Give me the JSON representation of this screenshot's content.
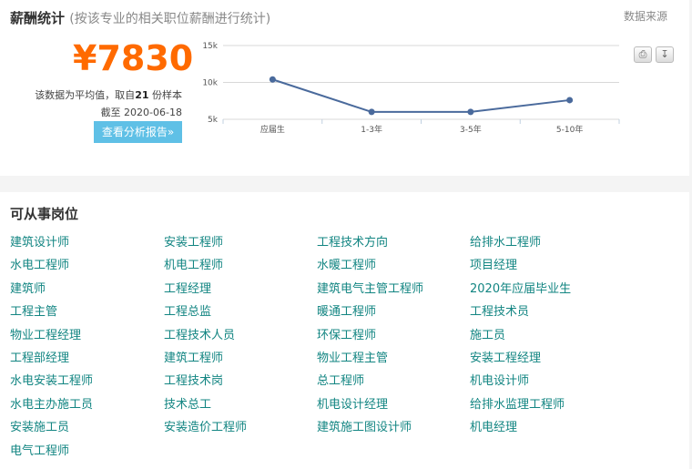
{
  "salary": {
    "title": "薪酬统计",
    "subtitle": "(按该专业的相关职位薪酬进行统计)",
    "source_link": "数据来源",
    "amount": "¥7830",
    "note_prefix": "该数据为平均值，取自",
    "sample_count": "21",
    "note_suffix": "份样本",
    "date_note": "截至 2020-06-18",
    "report_button": "查看分析报告»",
    "print_icon": "print-icon",
    "download_icon": "download-icon"
  },
  "chart_data": {
    "type": "line",
    "categories": [
      "应届生",
      "1-3年",
      "3-5年",
      "5-10年"
    ],
    "values": [
      10400,
      6000,
      6000,
      7600
    ],
    "ylim": [
      5000,
      15000
    ],
    "yticks": [
      5000,
      10000,
      15000
    ],
    "ytick_labels": [
      "5k",
      "10k",
      "15k"
    ],
    "grid": true,
    "line_color": "#4a6a9c"
  },
  "jobs": {
    "title": "可从事岗位",
    "link_color": "#128582",
    "items": [
      "建筑设计师",
      "安装工程师",
      "工程技术方向",
      "给排水工程师",
      "水电工程师",
      "机电工程师",
      "水暖工程师",
      "项目经理",
      "建筑师",
      "工程经理",
      "建筑电气主管工程师",
      "2020年应届毕业生",
      "工程主管",
      "工程总监",
      "暖通工程师",
      "工程技术员",
      "物业工程经理",
      "工程技术人员",
      "环保工程师",
      "施工员",
      "工程部经理",
      "建筑工程师",
      "物业工程主管",
      "安装工程经理",
      "水电安装工程师",
      "工程技术岗",
      "总工程师",
      "机电设计师",
      "水电主办施工员",
      "技术总工",
      "机电设计经理",
      "给排水监理工程师",
      "安装施工员",
      "安装造价工程师",
      "建筑施工图设计师",
      "机电经理",
      "电气工程师"
    ]
  }
}
